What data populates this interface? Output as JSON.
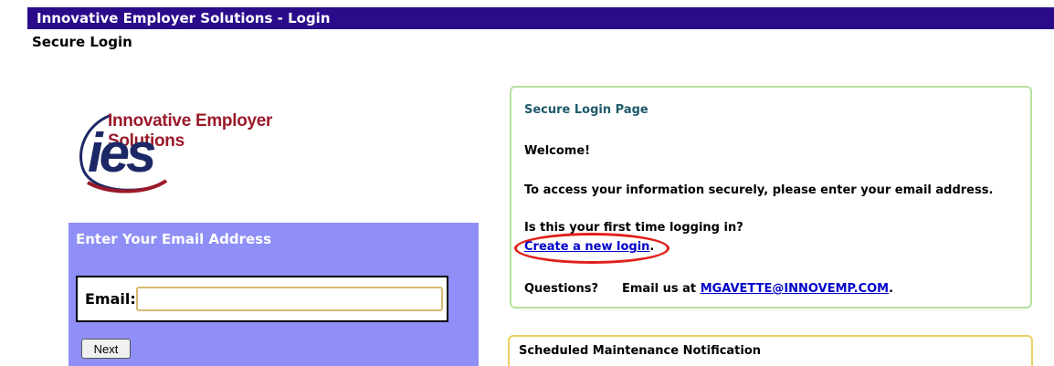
{
  "header": {
    "title": "Innovative Employer Solutions - Login",
    "subtitle": "Secure Login"
  },
  "logo": {
    "brand_text": "Innovative Employer Solutions",
    "monogram": "ies"
  },
  "email_panel": {
    "heading": "Enter Your Email Address",
    "field_label": "Email:",
    "field_value": "",
    "next_label": "Next"
  },
  "info_panel": {
    "title": "Secure Login Page",
    "welcome": "Welcome!",
    "instructions": "To access your information securely, please enter your email address.",
    "first_time": "Is this your first time logging in?",
    "create_link": "Create a new login",
    "create_link_suffix": ".",
    "questions_label": "Questions?",
    "email_us_text": "Email us at",
    "email_link": "MGAVETTE@INNOVEMP.COM",
    "email_suffix": "."
  },
  "maintenance": {
    "title": "Scheduled Maintenance Notification"
  },
  "colors": {
    "title_bar": "#2a0c8a",
    "email_panel_bg": "#8f8ff7",
    "info_border": "#b8e0a0",
    "maint_border": "#ecd060",
    "highlight": "#e0201a",
    "logo_red": "#9a1a2a",
    "logo_navy": "#1c2766"
  }
}
